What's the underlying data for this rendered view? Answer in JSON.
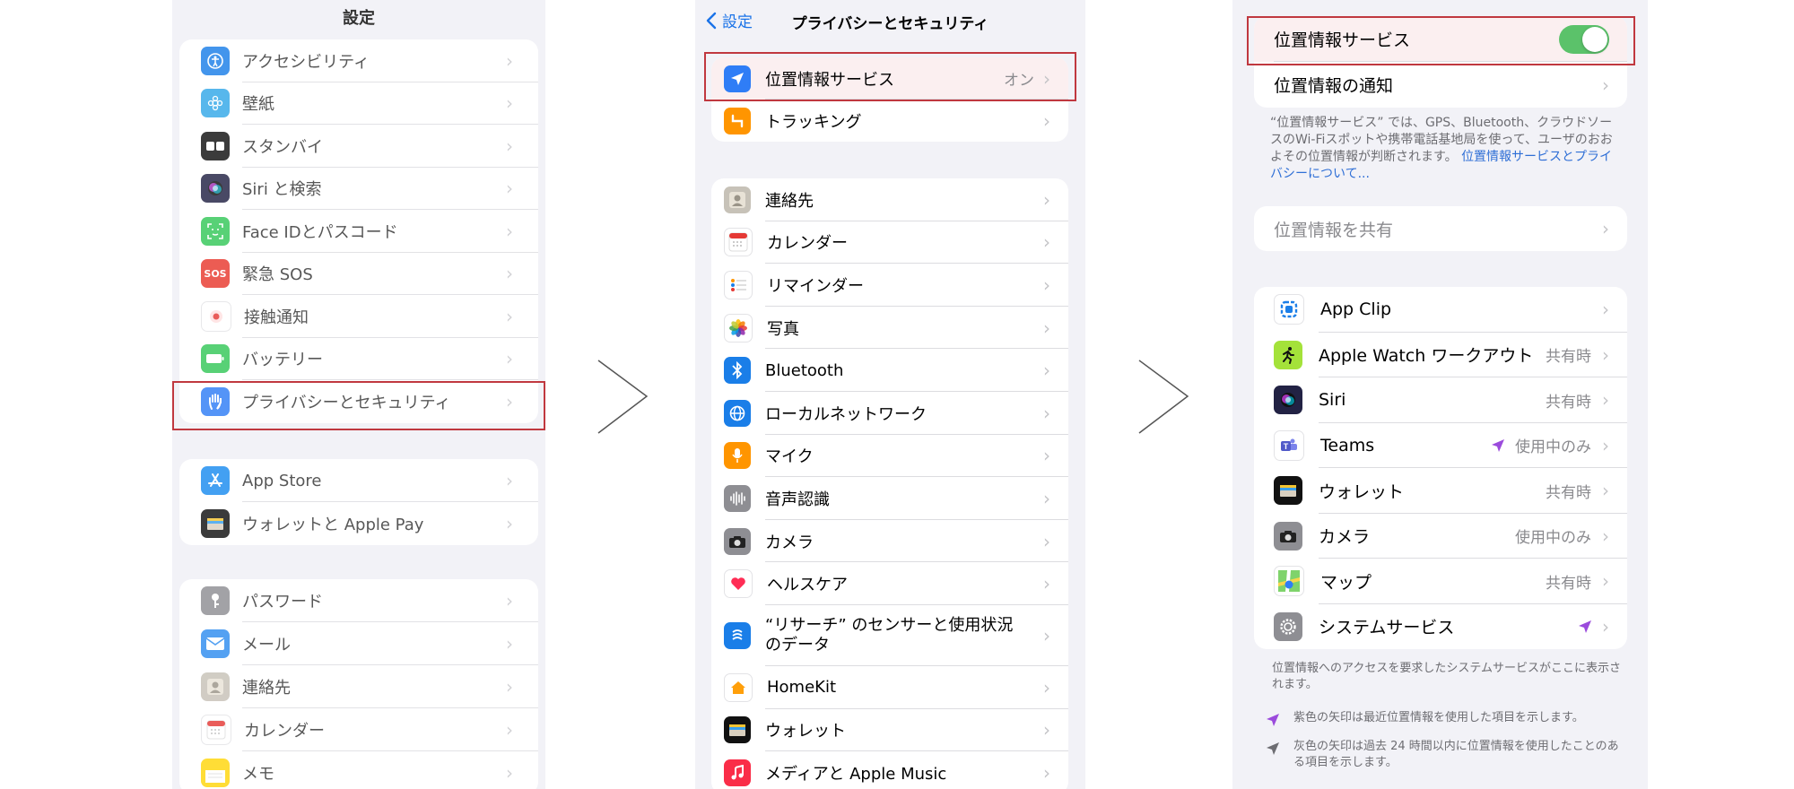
{
  "screen1": {
    "title": "設定",
    "group1": [
      {
        "label": "アクセシビリティ",
        "icon": "accessibility-icon",
        "color": "#1a7ee8"
      },
      {
        "label": "壁紙",
        "icon": "wallpaper-icon",
        "color": "#33a8e8"
      },
      {
        "label": "スタンバイ",
        "icon": "standby-icon",
        "color": "#111111"
      },
      {
        "label": "Siri と検索",
        "icon": "siri-icon",
        "color": "#222244"
      },
      {
        "label": "Face IDとパスコード",
        "icon": "face-id-icon",
        "color": "#34c759"
      },
      {
        "label": "緊急 SOS",
        "icon": "sos-icon",
        "color": "#e8392e",
        "glyph": "SOS"
      },
      {
        "label": "接触通知",
        "icon": "exposure-notification-icon",
        "color": "#ffffff"
      },
      {
        "label": "バッテリー",
        "icon": "battery-icon",
        "color": "#34c759"
      },
      {
        "label": "プライバシーとセキュリティ",
        "icon": "privacy-hand-icon",
        "color": "#2f7df6"
      }
    ],
    "group2": [
      {
        "label": "App Store",
        "icon": "app-store-icon",
        "color": "#1a8cf0"
      },
      {
        "label": "ウォレットと Apple Pay",
        "icon": "wallet-icon",
        "color": "#111111"
      }
    ],
    "group3": [
      {
        "label": "パスワード",
        "icon": "key-icon",
        "color": "#8e8e93"
      },
      {
        "label": "メール",
        "icon": "mail-icon",
        "color": "#2f8df0"
      },
      {
        "label": "連絡先",
        "icon": "contacts-icon",
        "color": "#c7c2b8"
      },
      {
        "label": "カレンダー",
        "icon": "calendar-icon",
        "color": "#ffffff"
      },
      {
        "label": "メモ",
        "icon": "notes-icon",
        "color": "#ffd60a"
      }
    ]
  },
  "screen2": {
    "back_label": "設定",
    "title": "プライバシーとセキュリティ",
    "group1": [
      {
        "label": "位置情報サービス",
        "value": "オン",
        "icon": "location-arrow-icon",
        "color": "#2f7df6"
      },
      {
        "label": "トラッキング",
        "value": "",
        "icon": "tracking-icon",
        "color": "#ff9500"
      }
    ],
    "group2": [
      {
        "label": "連絡先",
        "icon": "contacts-icon",
        "color": "#c7c2b8"
      },
      {
        "label": "カレンダー",
        "icon": "calendar-icon",
        "color": "#ffffff"
      },
      {
        "label": "リマインダー",
        "icon": "reminders-icon",
        "color": "#ffffff"
      },
      {
        "label": "写真",
        "icon": "photos-icon",
        "color": "#ffffff"
      },
      {
        "label": "Bluetooth",
        "icon": "bluetooth-icon",
        "color": "#1a7ee8"
      },
      {
        "label": "ローカルネットワーク",
        "icon": "local-network-icon",
        "color": "#1a7ee8"
      },
      {
        "label": "マイク",
        "icon": "microphone-icon",
        "color": "#ff9500"
      },
      {
        "label": "音声認識",
        "icon": "speech-recognition-icon",
        "color": "#8e8e93"
      },
      {
        "label": "カメラ",
        "icon": "camera-icon",
        "color": "#8e8e93"
      },
      {
        "label": "ヘルスケア",
        "icon": "health-heart-icon",
        "color": "#ffffff"
      },
      {
        "label": "“リサーチ” のセンサーと使用状況",
        "label2": "のデータ",
        "icon": "research-icon",
        "color": "#1a7ee8"
      },
      {
        "label": "HomeKit",
        "icon": "homekit-icon",
        "color": "#ffffff"
      },
      {
        "label": "ウォレット",
        "icon": "wallet-icon",
        "color": "#111111"
      },
      {
        "label": "メディアと Apple Music",
        "icon": "music-icon",
        "color": "#fa2d48"
      }
    ]
  },
  "screen3": {
    "location_services_label": "位置情報サービス",
    "location_services_on": true,
    "location_alerts_label": "位置情報の通知",
    "description": "“位置情報サービス” では、GPS、Bluetooth、クラウドソースのWi-Fiスポットや携帯電話基地局を使って、ユーザのおおよその位置情報が判断されます。",
    "description_link": "位置情報サービスとプライバシーについて...",
    "share_location_label": "位置情報を共有",
    "apps": [
      {
        "label": "App Clip",
        "value": "",
        "arrow": "",
        "icon": "app-clip-icon",
        "color": "#ffffff"
      },
      {
        "label": "Apple Watch ワークアウト",
        "value": "共有時",
        "arrow": "",
        "icon": "workout-icon",
        "color": "#a4e23a"
      },
      {
        "label": "Siri",
        "value": "共有時",
        "arrow": "",
        "icon": "siri-icon",
        "color": "#222244"
      },
      {
        "label": "Teams",
        "value": "使用中のみ",
        "arrow": "purple",
        "icon": "teams-icon",
        "color": "#ffffff"
      },
      {
        "label": "ウォレット",
        "value": "共有時",
        "arrow": "",
        "icon": "wallet-icon",
        "color": "#111111"
      },
      {
        "label": "カメラ",
        "value": "使用中のみ",
        "arrow": "",
        "icon": "camera-icon",
        "color": "#8e8e93"
      },
      {
        "label": "マップ",
        "value": "共有時",
        "arrow": "",
        "icon": "maps-icon",
        "color": "#ffffff"
      },
      {
        "label": "システムサービス",
        "value": "",
        "arrow": "purple",
        "icon": "gear-icon",
        "color": "#8e8e93"
      }
    ],
    "system_note": "位置情報へのアクセスを要求したシステムサービスがここに表示されます。",
    "legend_purple": "紫色の矢印は最近位置情報を使用した項目を示します。",
    "legend_gray": "灰色の矢印は過去 24 時間以内に位置情報を使用したことのある項目を示します。",
    "purple_color": "#9b4bdc",
    "gray_color": "#6d6d72"
  },
  "colors": {
    "highlight": "#c0383f",
    "toggle_on": "#5bc26a",
    "link": "#2f6fd6"
  }
}
